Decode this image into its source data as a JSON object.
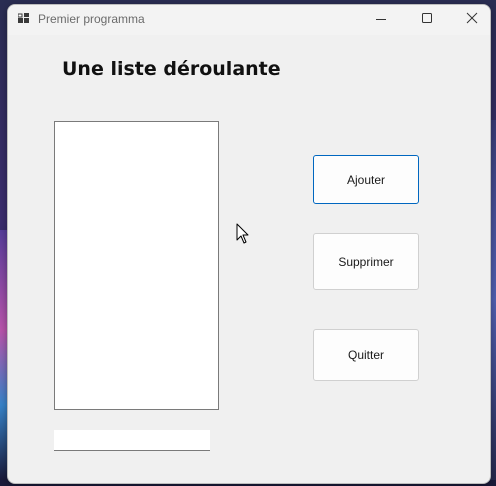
{
  "window": {
    "title": "Premier programma",
    "controls": {
      "minimize_icon": "minimize-icon",
      "maximize_icon": "maximize-icon",
      "close_icon": "close-icon"
    }
  },
  "form": {
    "heading": "Une liste déroulante",
    "listbox": {
      "items": []
    },
    "input": {
      "value": "",
      "placeholder": ""
    },
    "buttons": {
      "add_label": "Ajouter",
      "delete_label": "Supprimer",
      "quit_label": "Quitter"
    }
  },
  "colors": {
    "window_bg": "#f0f0f0",
    "focus_border": "#0067c0"
  }
}
